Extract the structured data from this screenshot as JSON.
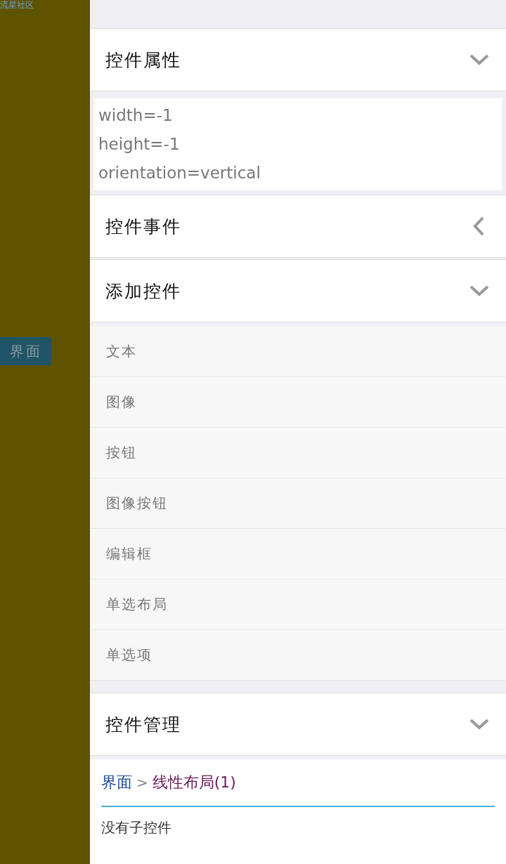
{
  "sidebar": {
    "title": "流星社区",
    "button": "界面"
  },
  "sections": [
    {
      "title": "控件属性",
      "expanded": true,
      "kind": "text",
      "lines": [
        "width=-1",
        "height=-1",
        "orientation=vertical"
      ]
    },
    {
      "title": "控件事件",
      "expanded": false
    },
    {
      "title": "添加控件",
      "expanded": true,
      "kind": "list",
      "items": [
        "文本",
        "图像",
        "按钮",
        "图像按钮",
        "编辑框",
        "单选布局",
        "单选项"
      ]
    },
    {
      "title": "控件管理",
      "expanded": true
    }
  ],
  "breadcrumb": {
    "root": "界面",
    "separator": ">",
    "current": "线性布局(1)"
  },
  "empty_message": "没有子控件"
}
